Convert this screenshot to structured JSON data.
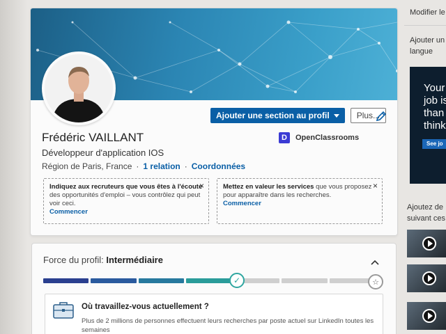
{
  "profile": {
    "name": "Frédéric VAILLANT",
    "headline": "Développeur d'application IOS",
    "location": "Région de Paris, France",
    "separator": "·",
    "connections": "1 relation",
    "contact_info": "Coordonnées",
    "company": "OpenClassrooms",
    "company_logo_letter": "D"
  },
  "actions": {
    "add_section": "Ajouter une section au profil",
    "more": "Plus..."
  },
  "tips": [
    {
      "text_pre": "",
      "text_strong": "Indiquez aux recruteurs que vous êtes à l'écoute",
      "text_post": " des opportunités d'emploi – vous contrôlez qui peut voir ceci.",
      "link": "Commencer",
      "close": "×"
    },
    {
      "text_pre": "",
      "text_strong": "Mettez en valeur les services",
      "text_post": " que vous proposez pour apparaître dans les recherches.",
      "link": "Commencer",
      "close": "×"
    }
  ],
  "strength": {
    "label": "Force du profil: ",
    "level": "Intermédiaire",
    "progress_fraction": 0.6,
    "segment_colors": [
      "#2a3f8f",
      "#2a5a9e",
      "#27799e",
      "#2a9c9a",
      "#cfcfcf",
      "#cfcfcf",
      "#cfcfcf"
    ],
    "check_glyph": "✓",
    "star_glyph": "☆"
  },
  "work_prompt": {
    "question": "Où travaillez-vous actuellement ?",
    "description": "Plus de 2 millions de personnes effectuent leurs recherches par poste actuel sur LinkedIn toutes les semaines"
  },
  "rail": {
    "edit_profile": "Modifier le",
    "add_lang": "Ajouter un",
    "add_lang_2": "langue",
    "ad_lines": [
      "Your",
      "job is",
      "than",
      "think"
    ],
    "ad_button": "See jo",
    "suggest": "Ajoutez de",
    "suggest_2": "suivant ces"
  }
}
